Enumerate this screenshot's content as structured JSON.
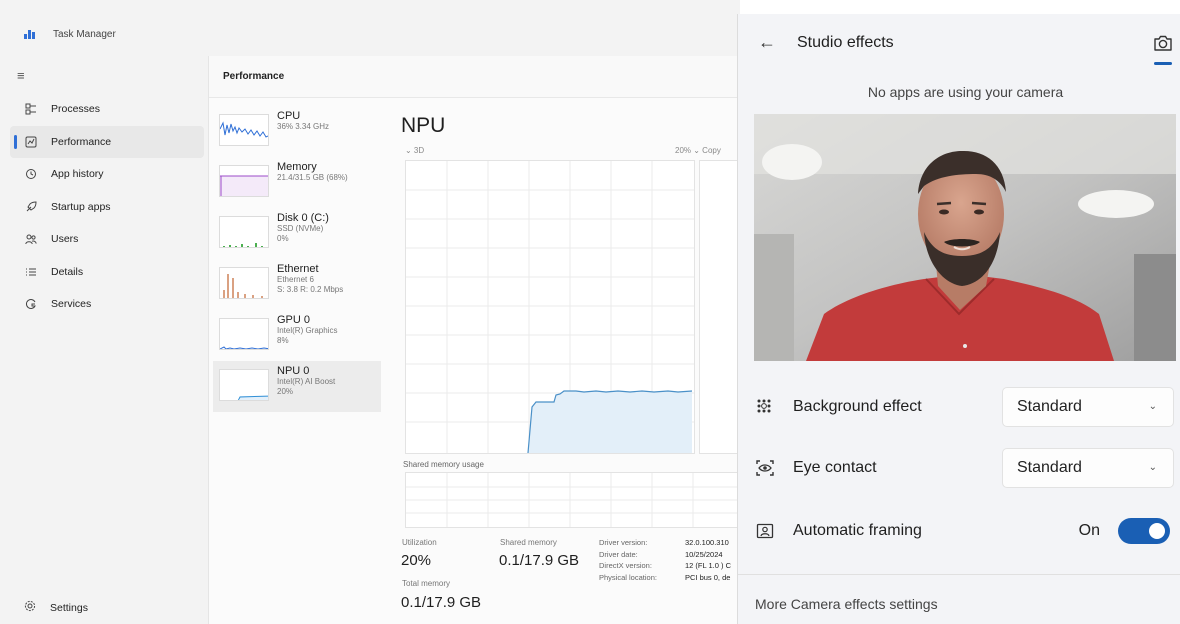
{
  "task_manager": {
    "title": "Task Manager",
    "nav": [
      {
        "label": "Processes",
        "icon": "processes-icon"
      },
      {
        "label": "Performance",
        "icon": "performance-icon",
        "active": true
      },
      {
        "label": "App history",
        "icon": "app-history-icon"
      },
      {
        "label": "Startup apps",
        "icon": "startup-apps-icon"
      },
      {
        "label": "Users",
        "icon": "users-icon"
      },
      {
        "label": "Details",
        "icon": "details-icon"
      },
      {
        "label": "Services",
        "icon": "services-icon"
      }
    ],
    "settings_label": "Settings",
    "section_title": "Performance",
    "resources": [
      {
        "name": "CPU",
        "sub1": "36% 3.34 GHz",
        "sub2": "",
        "color": "#2f6fd6"
      },
      {
        "name": "Memory",
        "sub1": "21.4/31.5 GB (68%)",
        "sub2": "",
        "color": "#9b4bc9"
      },
      {
        "name": "Disk 0 (C:)",
        "sub1": "SSD (NVMe)",
        "sub2": "0%",
        "color": "#4caf50"
      },
      {
        "name": "Ethernet",
        "sub1": "Ethernet 6",
        "sub2": "S: 3.8 R: 0.2 Mbps",
        "color": "#c0622f"
      },
      {
        "name": "GPU 0",
        "sub1": "Intel(R) Graphics",
        "sub2": "8%",
        "color": "#2f6fd6"
      },
      {
        "name": "NPU 0",
        "sub1": "Intel(R) AI Boost",
        "sub2": "20%",
        "color": "#2f8fd6"
      }
    ],
    "detail": {
      "title": "NPU",
      "graph_left_label": "⌄ 3D",
      "graph_right_label": "20% ⌄ Copy",
      "shared_memory_usage_label": "Shared memory usage",
      "utilization_label": "Utilization",
      "utilization_value": "20%",
      "shared_memory_label": "Shared memory",
      "shared_memory_value": "0.1/17.9 GB",
      "total_memory_label": "Total memory",
      "total_memory_value": "0.1/17.9 GB",
      "driver_labels": [
        "Driver version:",
        "Driver date:",
        "DirectX version:",
        "Physical location:"
      ],
      "driver_values": [
        "32.0.100.310",
        "10/25/2024",
        "12 (FL 1.0 ) C",
        "PCI bus 0, de"
      ]
    }
  },
  "studio_effects": {
    "title": "Studio effects",
    "camera_status": "No apps are using your camera",
    "background_effect_label": "Background effect",
    "background_effect_value": "Standard",
    "eye_contact_label": "Eye contact",
    "eye_contact_value": "Standard",
    "auto_framing_label": "Automatic framing",
    "auto_framing_state": "On",
    "more_link": "More Camera effects settings",
    "accent": "#1a5fb4"
  }
}
